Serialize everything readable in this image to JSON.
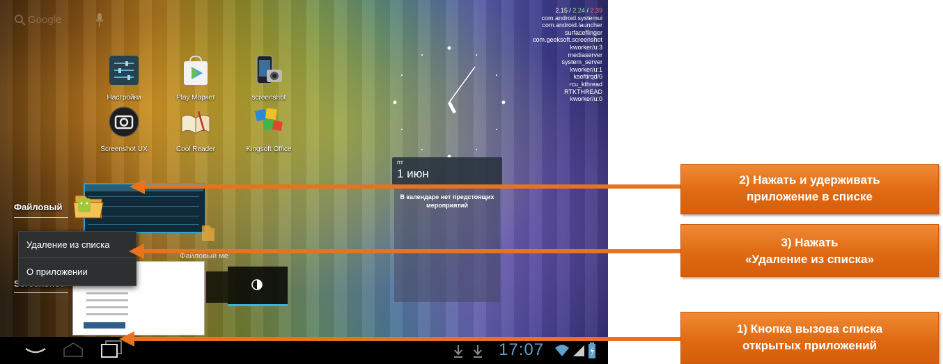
{
  "search": {
    "text": "Google"
  },
  "stats": {
    "load": [
      "2.15",
      "2.24",
      "2.39"
    ],
    "processes": [
      "com.android.systemui",
      "com.android.launcher",
      "surfaceflinger",
      "com.geeksoft.screenshot",
      "kworker/u:3",
      "mediaserver",
      "system_server",
      "kworker/u:1",
      "ksoftirqd/0",
      "rcu_kthread",
      "RTKTHREAD",
      "kworker/u:0"
    ]
  },
  "apps": [
    {
      "label": "Настройки",
      "icon": "settings-icon"
    },
    {
      "label": "Play Маркет",
      "icon": "play-store-icon"
    },
    {
      "label": "screenshot",
      "icon": "phone-camera-icon"
    },
    {
      "label": "Screenshot UX",
      "icon": "camera-icon"
    },
    {
      "label": "Cool Reader",
      "icon": "book-icon"
    },
    {
      "label": "Kingsoft Office",
      "icon": "office-icon"
    }
  ],
  "calendar": {
    "day_of_week": "пт",
    "date": "1 июн",
    "empty_text": "В календаре нет предстоящих мероприятий"
  },
  "recent_apps": {
    "item1": "Файловый",
    "item2": "Screenshot",
    "partial_label": "Файловый ме"
  },
  "context_menu": {
    "remove": "Удаление из списка",
    "about": "О приложении"
  },
  "status_bar": {
    "time": "17:07"
  },
  "callouts": {
    "step2": [
      "2) Нажать и удерживать",
      "приложение в списке"
    ],
    "step3": [
      "3) Нажать",
      "«Удаление из списка»"
    ],
    "step1": [
      "1) Кнопка вызова списка",
      "открытых приложений"
    ]
  },
  "colors": {
    "accent": "#e8731e",
    "holo_blue": "#33b5e5"
  }
}
